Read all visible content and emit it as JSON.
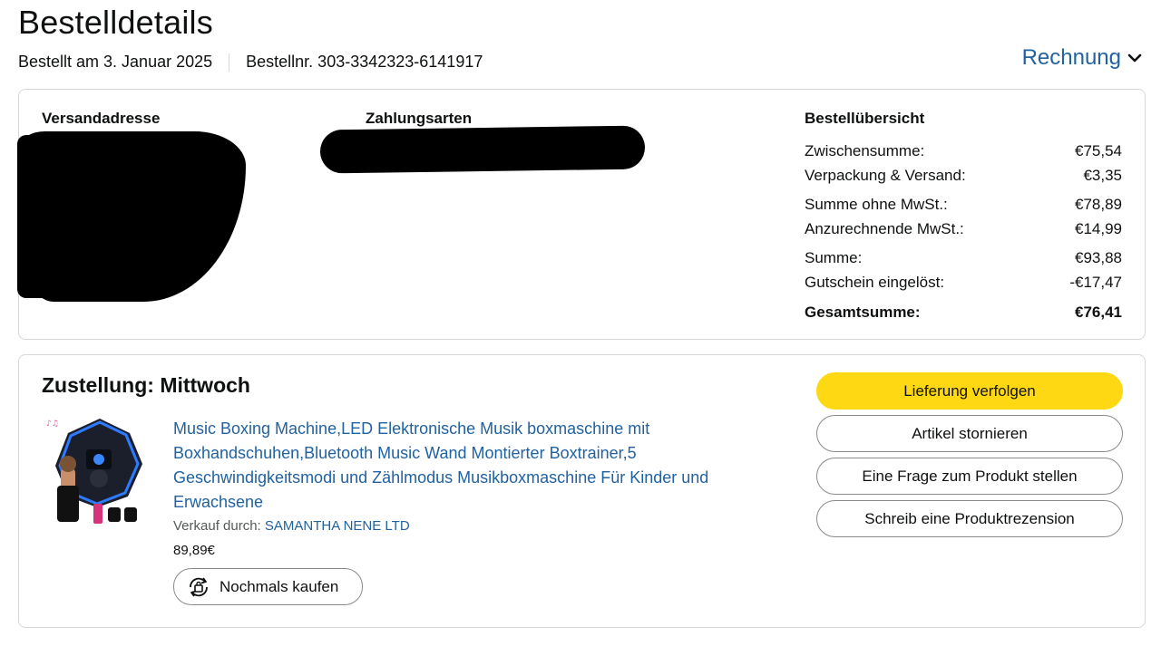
{
  "header": {
    "title": "Bestelldetails",
    "ordered_on": "Bestellt am 3. Januar 2025",
    "order_number": "Bestellnr. 303-3342323-6141917",
    "invoice_label": "Rechnung"
  },
  "info": {
    "shipping_heading": "Versandadresse",
    "payment_heading": "Zahlungsarten",
    "summary": {
      "heading": "Bestellübersicht",
      "rows": [
        {
          "label": "Zwischensumme:",
          "value": "€75,54"
        },
        {
          "label": "Verpackung & Versand:",
          "value": "€3,35"
        },
        {
          "label": "Summe ohne MwSt.:",
          "value": "€78,89"
        },
        {
          "label": "Anzurechnende MwSt.:",
          "value": "€14,99"
        },
        {
          "label": "Summe:",
          "value": "€93,88"
        },
        {
          "label": "Gutschein eingelöst:",
          "value": "-€17,47"
        }
      ],
      "total_label": "Gesamtsumme:",
      "total_value": "€76,41"
    }
  },
  "delivery": {
    "title": "Zustellung: Mittwoch",
    "product": {
      "title": "Music Boxing Machine,LED Elektronische Musik boxmaschine mit Boxhandschuhen,Bluetooth Music Wand Montierter Boxtrainer,5 Geschwindigkeitsmodi und Zählmodus Musikboxmaschine Für Kinder und Erwachsene",
      "seller_prefix": "Verkauf durch:",
      "seller_name": "SAMANTHA NENE LTD",
      "price": "89,89€",
      "buy_again": "Nochmals kaufen"
    },
    "actions": {
      "track": "Lieferung verfolgen",
      "cancel": "Artikel stornieren",
      "question": "Eine Frage zum Produkt stellen",
      "review": "Schreib eine Produktrezension"
    }
  },
  "colors": {
    "link": "#2162a1",
    "primary_button": "#ffd814",
    "border": "#d5d9d9"
  },
  "icons": {
    "invoice_chevron": "chevron-down-icon",
    "buy_again": "reorder-bag-icon"
  }
}
